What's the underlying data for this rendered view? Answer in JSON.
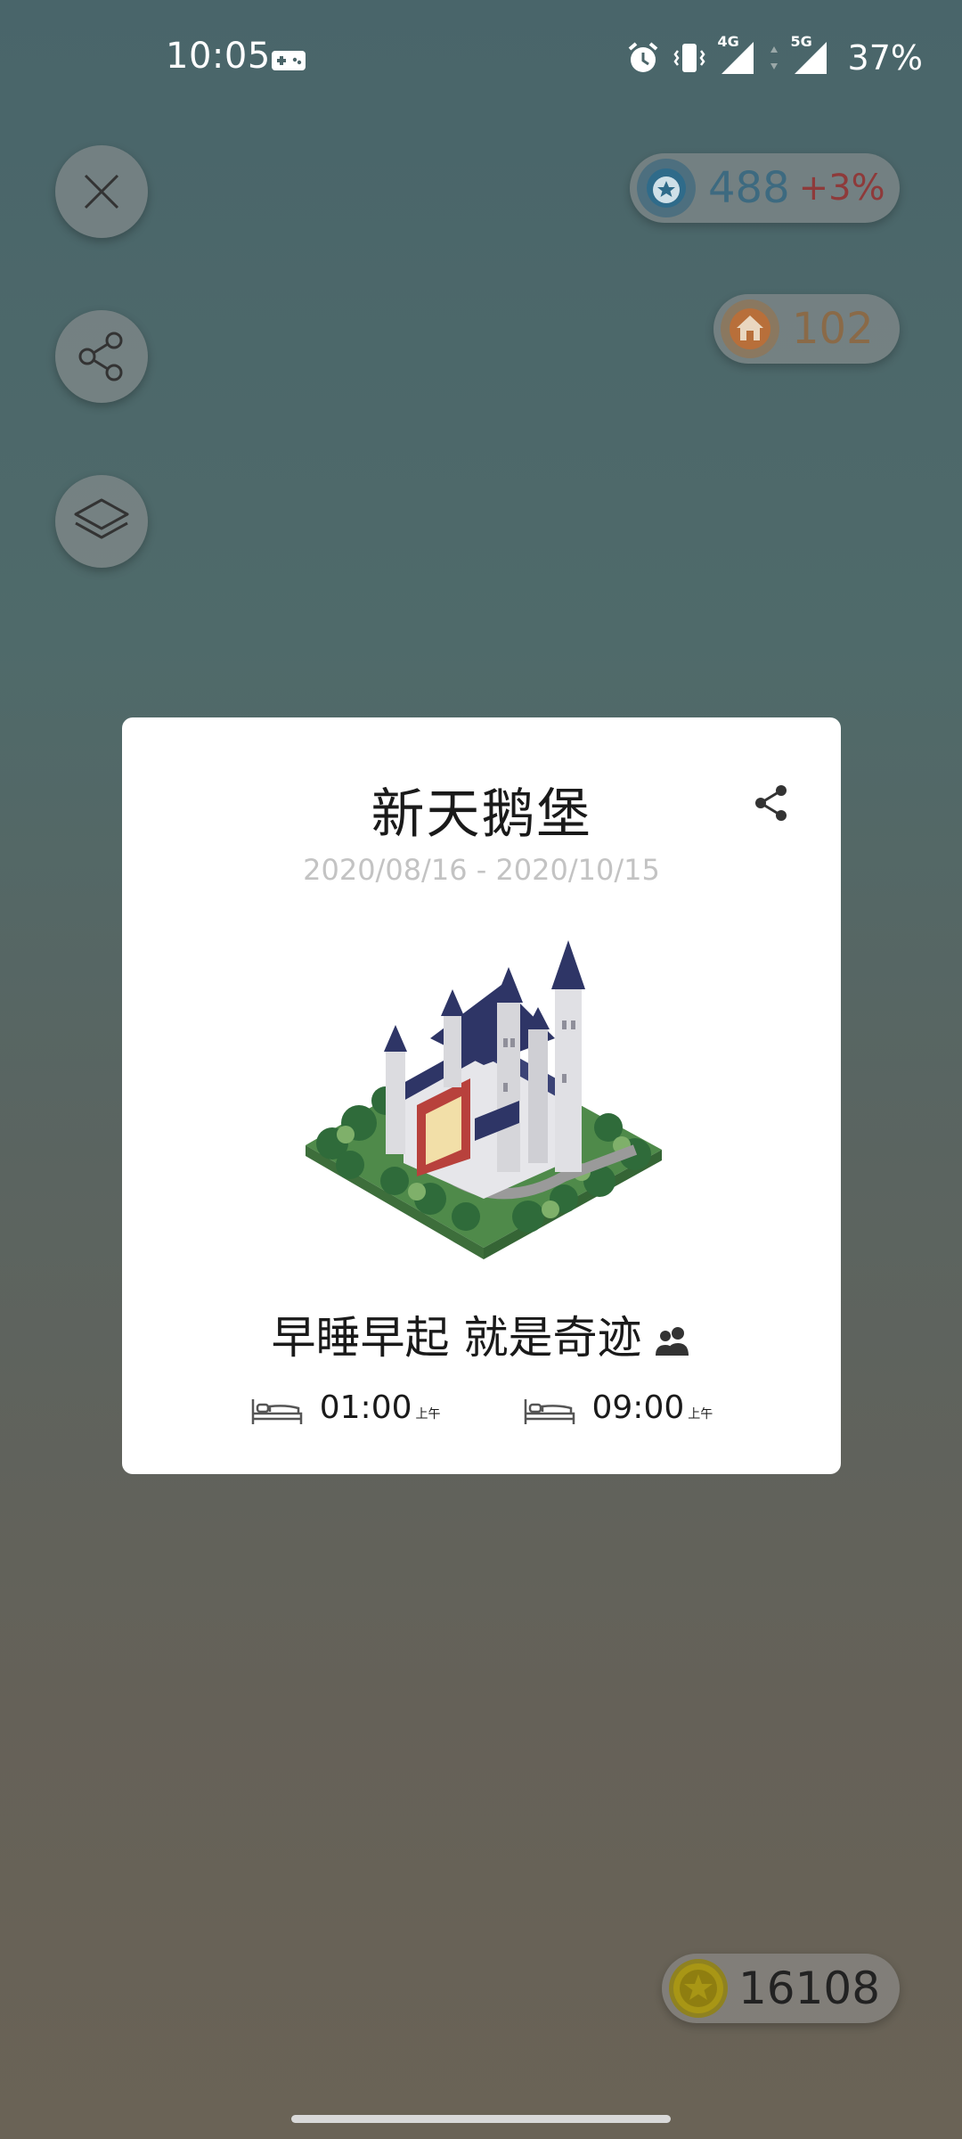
{
  "status_bar": {
    "time": "10:05",
    "network_4g": "4G",
    "network_5g": "5G",
    "battery": "37%"
  },
  "side_buttons": [
    {
      "icon": "close-icon"
    },
    {
      "icon": "share-icon"
    },
    {
      "icon": "layers-icon"
    }
  ],
  "stats": {
    "coins_value": "488",
    "coins_growth": "+3%",
    "houses_value": "102",
    "gold_value": "16108"
  },
  "card": {
    "title": "新天鹅堡",
    "date_range": "2020/08/16 - 2020/10/15",
    "slogan": "早睡早起 就是奇迹",
    "sleep_time": "01:00",
    "sleep_ampm": "上午",
    "wake_time": "09:00",
    "wake_ampm": "上午"
  },
  "colors": {
    "coins": "#3d6a80",
    "growth": "#8e3a3a",
    "house": "#8a6a48"
  }
}
